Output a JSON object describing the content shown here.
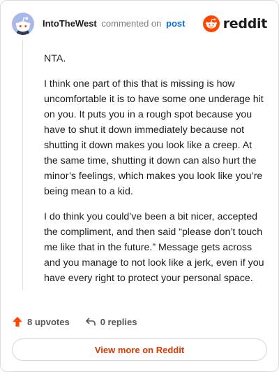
{
  "header": {
    "username": "IntoTheWest",
    "action": "commented on",
    "target": "post",
    "brand": "reddit"
  },
  "comment": {
    "paragraphs": [
      "NTA.",
      "I think one part of this that is missing is how uncomfortable it is to have some one underage hit on you. It puts you in a rough spot because you have to shut it down immediately because not shutting it down makes you look like a creep. At the same time, shutting it down can also hurt the minor’s feelings, which makes you look like you’re being mean to a kid.",
      "I do think you could’ve been a bit nicer, accepted the compliment, and then said “please don’t touch me like that in the future.” Message gets across and you manage to not look like a jerk, even if you have every right to protect your personal space."
    ]
  },
  "stats": {
    "upvotes": "8 upvotes",
    "replies": "0 replies"
  },
  "footer": {
    "view_more": "View more on Reddit"
  },
  "colors": {
    "brand_orange": "#ff4500",
    "link_blue": "#0a6dd6",
    "cta_text": "#d93a00",
    "avatar_bg": "#a9b8e8"
  },
  "icons": {
    "avatar": "snoo-avatar-icon",
    "logo": "reddit-logo-icon",
    "upvote": "upvote-arrow-icon",
    "reply": "reply-arrow-icon"
  }
}
